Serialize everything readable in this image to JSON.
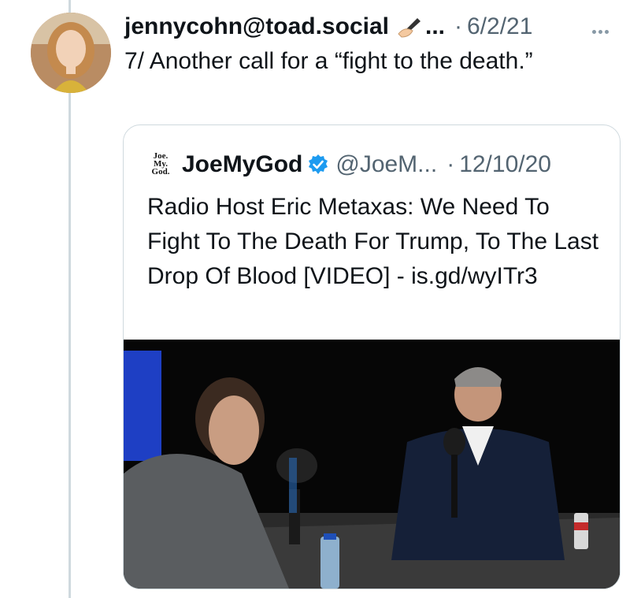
{
  "tweet": {
    "author": "jennycohn@toad.social",
    "name_emoji": "writing-hand-emoji",
    "name_truncation": "...",
    "separator": "·",
    "date": "6/2/21",
    "text": "7/ Another call for a “fight to the death.”"
  },
  "quote": {
    "logo_text": "Joe. My. God.",
    "name": "JoeMyGod",
    "handle": "@JoeM...",
    "separator": "·",
    "date": "12/10/20",
    "text": "Radio Host Eric Metaxas: We Need To Fight To The Death For Trump, To The Last Drop Of Blood [VIDEO] - is.gd/wyITr3",
    "verified_color": "#1d9bf0"
  },
  "colors": {
    "text": "#0f1419",
    "secondary": "#536471",
    "border": "#cfd9de"
  }
}
